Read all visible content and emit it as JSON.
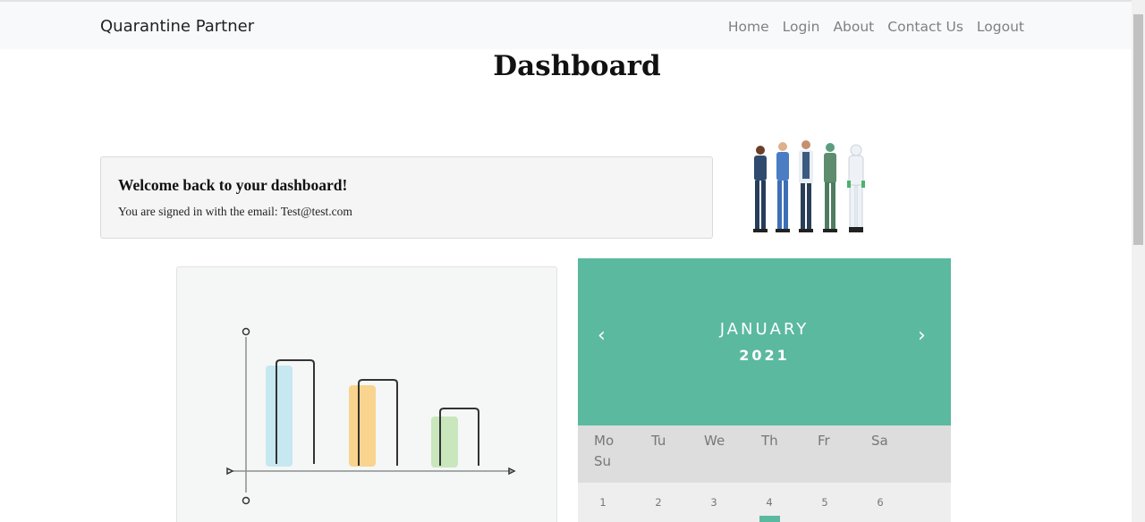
{
  "navbar": {
    "brand": "Quarantine Partner",
    "links": [
      "Home",
      "Login",
      "About",
      "Contact Us",
      "Logout"
    ]
  },
  "page": {
    "title": "Dashboard"
  },
  "welcome": {
    "heading": "Welcome back to your dashboard!",
    "text": "You are signed in with the email: Test@test.com"
  },
  "calendar": {
    "prev_icon": "chevron-left-icon",
    "next_icon": "chevron-right-icon",
    "prev": "‹",
    "next": "›",
    "month": "JANUARY",
    "year": "2021",
    "weekdays": [
      "Mo",
      "Tu",
      "We",
      "Th",
      "Fr",
      "Sa",
      "Su"
    ],
    "days": [
      "1",
      "2",
      "3",
      "4",
      "5",
      "6"
    ],
    "accent_color": "#5bb99f"
  },
  "colors": {
    "navbar_bg": "#f8f9fa",
    "calendar_header": "#5bb99f",
    "bar_blue": "#c6e8f0",
    "bar_orange": "#f8d48e",
    "bar_green": "#c9e6bd"
  }
}
